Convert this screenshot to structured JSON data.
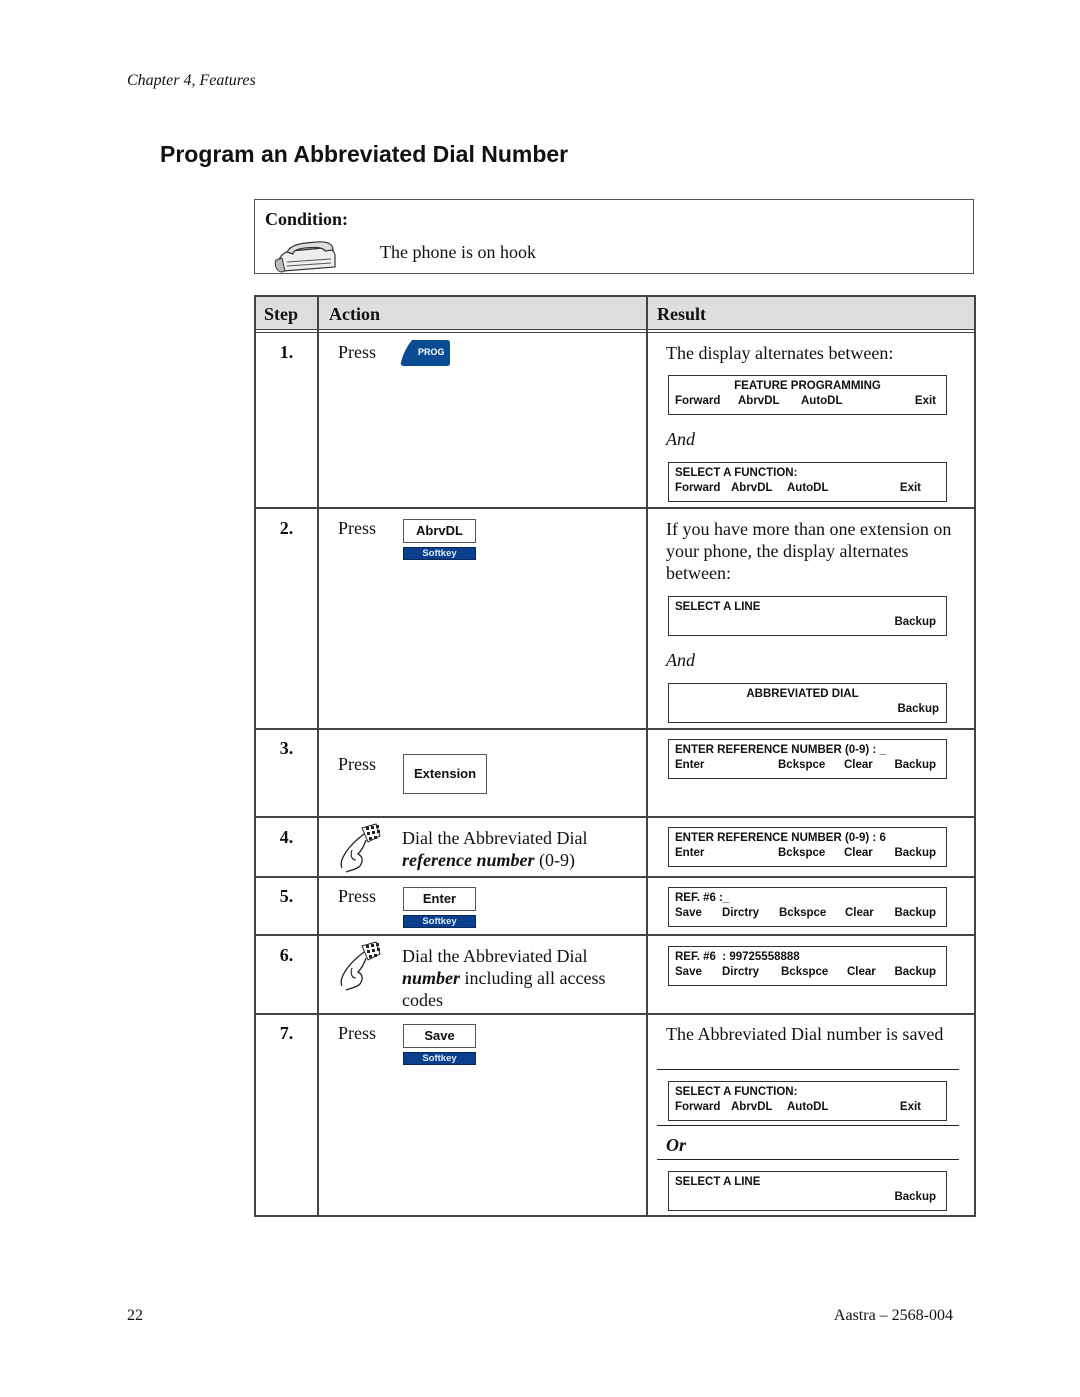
{
  "header": {
    "chapter": "Chapter 4, Features"
  },
  "title": "Program an Abbreviated Dial Number",
  "condition": {
    "label": "Condition:",
    "icon": "phone-on-hook-icon",
    "text": "The phone is on hook"
  },
  "table": {
    "headers": {
      "step": "Step",
      "action": "Action",
      "result": "Result"
    },
    "steps": [
      {
        "num": "1.",
        "action": {
          "type": "press",
          "label": "Press",
          "key": "PROG",
          "icon": "prog-key-icon"
        },
        "result": {
          "text": "The display alternates between:",
          "connector": "And",
          "displays": [
            {
              "line1": "FEATURE PROGRAMMING",
              "softkeys": [
                "Forward",
                "AbrvDL",
                "AutoDL",
                "Exit"
              ]
            },
            {
              "line1": "SELECT A FUNCTION:",
              "softkeys": [
                "Forward",
                "AbrvDL",
                "AutoDL",
                "Exit"
              ]
            }
          ]
        }
      },
      {
        "num": "2.",
        "action": {
          "type": "press-softkey",
          "label": "Press",
          "key": "AbrvDL",
          "tag": "Softkey"
        },
        "result": {
          "text": "If you have more than one extension on your phone, the display alternates between:",
          "connector": "And",
          "displays": [
            {
              "line1": "SELECT A LINE",
              "softkeys": [
                "Backup"
              ]
            },
            {
              "line1": "ABBREVIATED DIAL",
              "softkeys": [
                "Backup"
              ]
            }
          ]
        }
      },
      {
        "num": "3.",
        "action": {
          "type": "press",
          "label": "Press",
          "key": "Extension"
        },
        "result": {
          "displays": [
            {
              "line1": "ENTER REFERENCE NUMBER (0-9) : _",
              "softkeys": [
                "Enter",
                "Bckspce",
                "Clear",
                "Backup"
              ]
            }
          ]
        }
      },
      {
        "num": "4.",
        "action": {
          "type": "dial",
          "icon": "dialing-hand-icon",
          "text_before": "Dial the Abbreviated Dial",
          "emphasis": "reference number",
          "text_after": " (0-9)"
        },
        "result": {
          "displays": [
            {
              "line1": "ENTER REFERENCE NUMBER (0-9) : 6",
              "softkeys": [
                "Enter",
                "Bckspce",
                "Clear",
                "Backup"
              ]
            }
          ]
        }
      },
      {
        "num": "5.",
        "action": {
          "type": "press-softkey",
          "label": "Press",
          "key": "Enter",
          "tag": "Softkey"
        },
        "result": {
          "displays": [
            {
              "line1": "REF. #6 :_",
              "softkeys": [
                "Save",
                "Dirctry",
                "Bckspce",
                "Clear",
                "Backup"
              ]
            }
          ]
        }
      },
      {
        "num": "6.",
        "action": {
          "type": "dial",
          "icon": "dialing-hand-icon",
          "text_before": "Dial the Abbreviated Dial",
          "emphasis": "number",
          "text_after": " including all access codes"
        },
        "result": {
          "displays": [
            {
              "line1": "REF. #6  : 99725558888",
              "softkeys": [
                "Save",
                "Dirctry",
                "Bckspce",
                "Clear",
                "Backup"
              ]
            }
          ]
        }
      },
      {
        "num": "7.",
        "action": {
          "type": "press-softkey",
          "label": "Press",
          "key": "Save",
          "tag": "Softkey"
        },
        "result": {
          "text": "The Abbreviated Dial number is saved",
          "connector": "Or",
          "displays": [
            {
              "line1": "SELECT A FUNCTION:",
              "softkeys": [
                "Forward",
                "AbrvDL",
                "AutoDL",
                "Exit"
              ]
            },
            {
              "line1": "SELECT A LINE",
              "softkeys": [
                "Backup"
              ]
            }
          ]
        }
      }
    ]
  },
  "footer": {
    "page": "22",
    "doc": "Aastra – 2568-004"
  },
  "colors": {
    "softkey_tag": "#0a3f8c",
    "prog_key": "#0a4c94",
    "header_bg": "#dedede"
  }
}
